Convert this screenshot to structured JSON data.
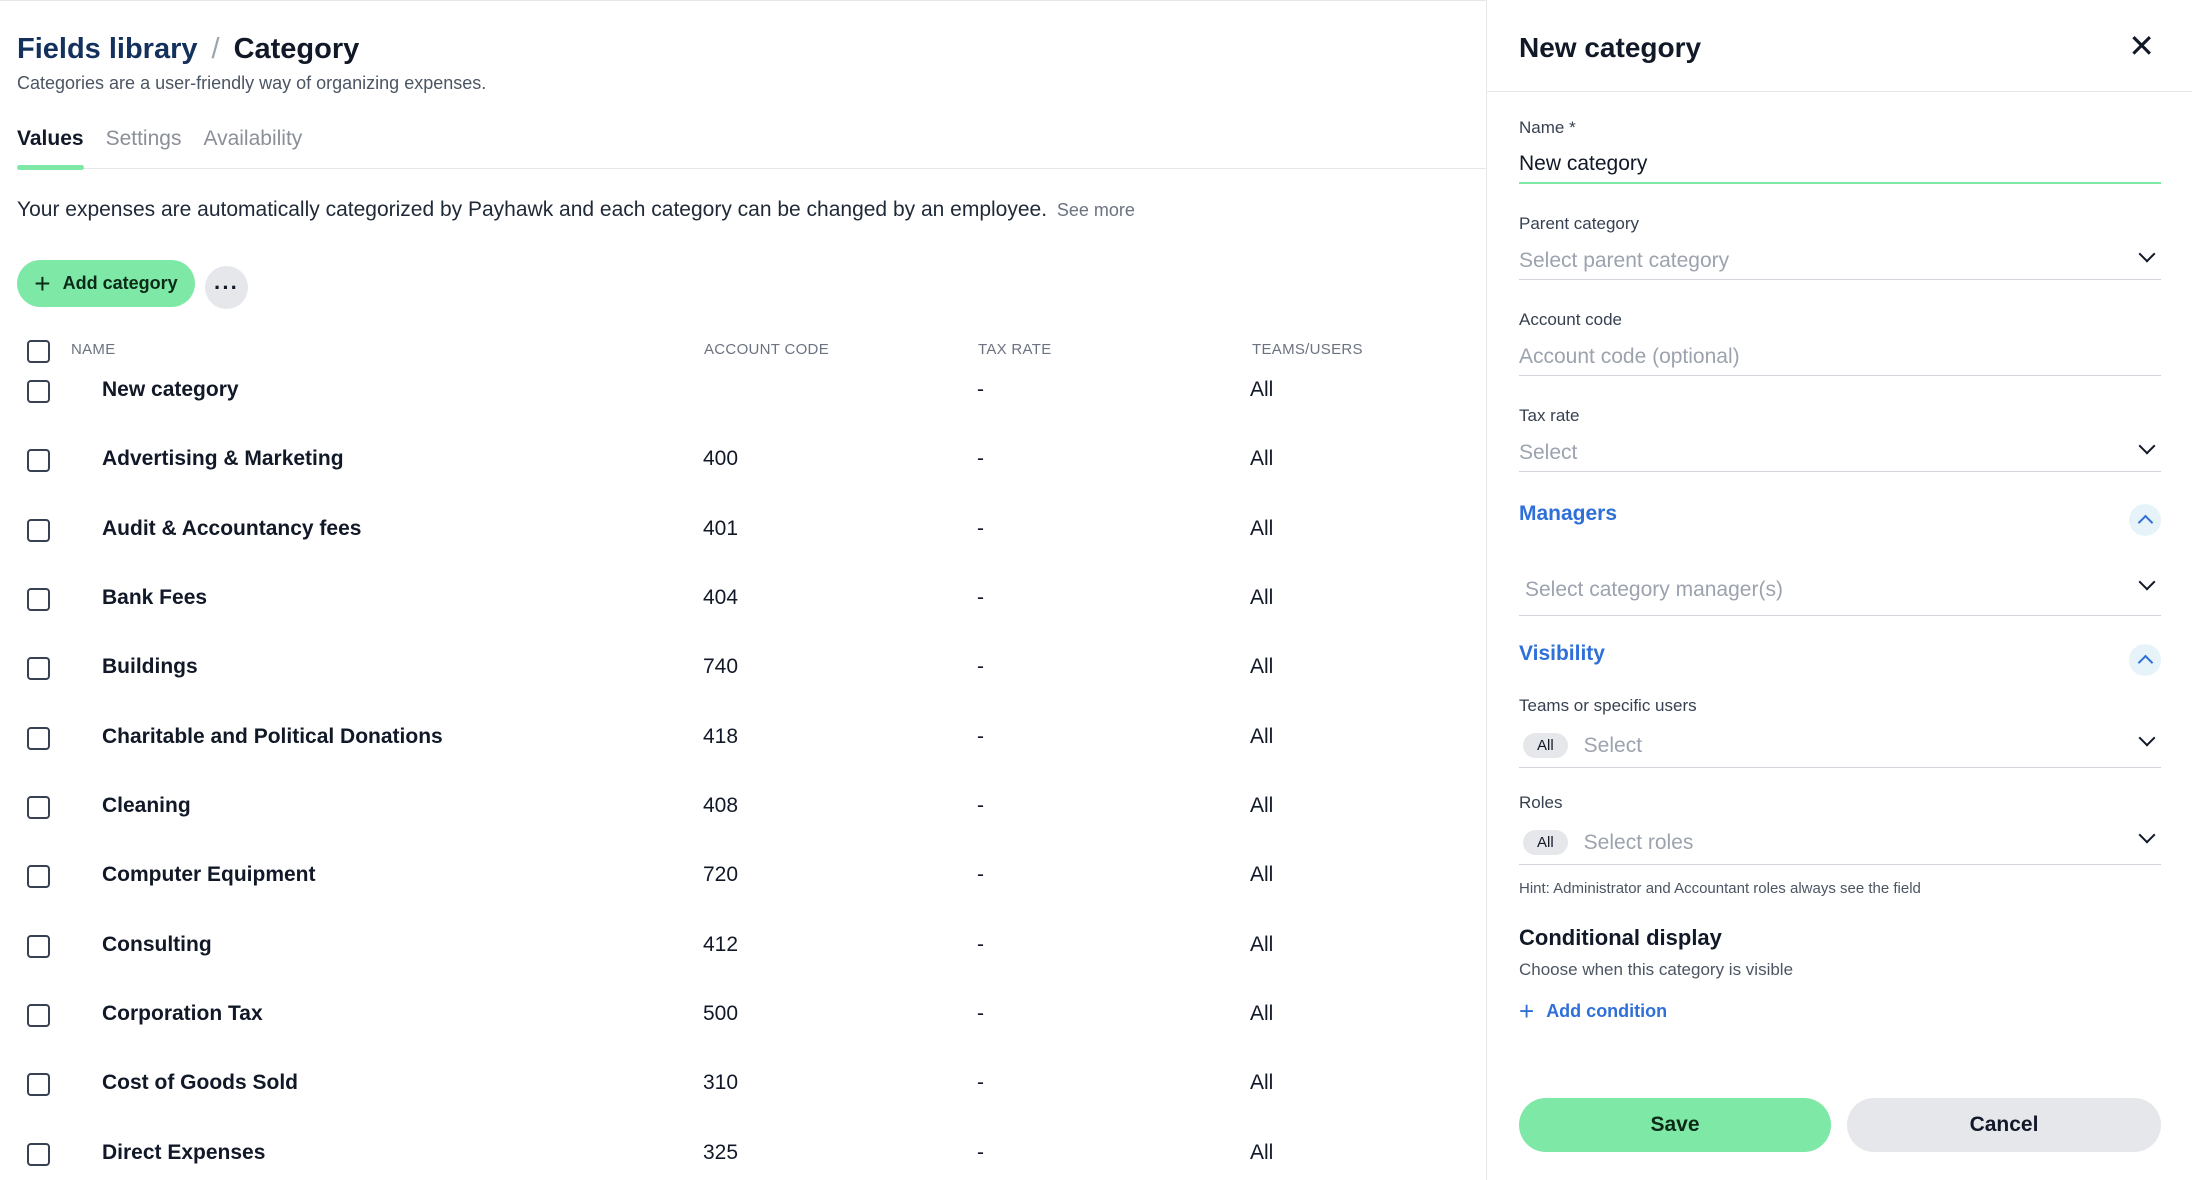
{
  "breadcrumb": {
    "parent": "Fields library",
    "separator": "/",
    "current": "Category"
  },
  "subtitle": "Categories are a user-friendly way of organizing expenses.",
  "tabs": [
    {
      "label": "Values",
      "active": true
    },
    {
      "label": "Settings",
      "active": false
    },
    {
      "label": "Availability",
      "active": false
    }
  ],
  "info": {
    "text": "Your expenses are automatically categorized by Payhawk and each category can be changed by an employee.",
    "see_more": "See more"
  },
  "toolbar": {
    "add_label": "Add category",
    "more_label": "···"
  },
  "table": {
    "columns": [
      "NAME",
      "ACCOUNT CODE",
      "TAX RATE",
      "TEAMS/USERS"
    ],
    "rows": [
      {
        "name": "New category",
        "code": "",
        "tax": "-",
        "teams": "All"
      },
      {
        "name": "Advertising & Marketing",
        "code": "400",
        "tax": "-",
        "teams": "All"
      },
      {
        "name": "Audit & Accountancy fees",
        "code": "401",
        "tax": "-",
        "teams": "All"
      },
      {
        "name": "Bank Fees",
        "code": "404",
        "tax": "-",
        "teams": "All"
      },
      {
        "name": "Buildings",
        "code": "740",
        "tax": "-",
        "teams": "All"
      },
      {
        "name": "Charitable and Political Donations",
        "code": "418",
        "tax": "-",
        "teams": "All"
      },
      {
        "name": "Cleaning",
        "code": "408",
        "tax": "-",
        "teams": "All"
      },
      {
        "name": "Computer Equipment",
        "code": "720",
        "tax": "-",
        "teams": "All"
      },
      {
        "name": "Consulting",
        "code": "412",
        "tax": "-",
        "teams": "All"
      },
      {
        "name": "Corporation Tax",
        "code": "500",
        "tax": "-",
        "teams": "All"
      },
      {
        "name": "Cost of Goods Sold",
        "code": "310",
        "tax": "-",
        "teams": "All"
      },
      {
        "name": "Direct Expenses",
        "code": "325",
        "tax": "-",
        "teams": "All"
      }
    ]
  },
  "panel": {
    "title": "New category",
    "close": "✕",
    "name": {
      "label": "Name *",
      "value": "New category"
    },
    "parent": {
      "label": "Parent category",
      "placeholder": "Select parent category"
    },
    "account": {
      "label": "Account code",
      "placeholder": "Account code (optional)"
    },
    "tax": {
      "label": "Tax rate",
      "placeholder": "Select"
    },
    "managers": {
      "title": "Managers",
      "placeholder": "Select category manager(s)"
    },
    "visibility": {
      "title": "Visibility"
    },
    "teams": {
      "label": "Teams or specific users",
      "pill": "All",
      "placeholder": "Select"
    },
    "roles": {
      "label": "Roles",
      "pill": "All",
      "placeholder": "Select roles"
    },
    "hint": "Hint: Administrator and Accountant roles always see the field",
    "conditional": {
      "title": "Conditional display",
      "subtitle": "Choose when this category is visible",
      "add_label": "Add condition"
    },
    "save": "Save",
    "cancel": "Cancel"
  },
  "colors": {
    "accent_green": "#7ee8a6",
    "link_blue": "#2f6fd8",
    "breadcrumb_navy": "#14315e"
  }
}
